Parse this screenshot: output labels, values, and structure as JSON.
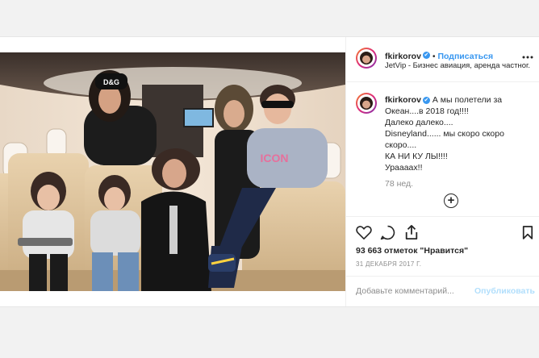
{
  "header": {
    "username": "fkirkorov",
    "verified_mark": "✔",
    "separator": "•",
    "follow_label": "Подписаться",
    "location": "JetVip - Бизнес авиация, аренда частног...",
    "more_icon": "more-horizontal-icon"
  },
  "caption": {
    "username": "fkirkorov",
    "lines": [
      "А мы полетели за",
      "Океан....в 2018 год!!!!",
      "Далеко далеко....",
      "Disneyland...... мы скоро скоро",
      "скоро....",
      "КА НИ КУ ЛЫ!!!!",
      "Ураааах!!"
    ],
    "time_ago": "78 нед.",
    "load_more_icon": "plus-circle-icon"
  },
  "actions": {
    "icons": [
      "heart-icon",
      "comment-icon",
      "share-icon",
      "bookmark-icon"
    ],
    "likes": "93 663 отметок \"Нравится\"",
    "date": "31 ДЕКАБРЯ 2017 Г."
  },
  "comment": {
    "placeholder": "Добавьте комментарий...",
    "publish_label": "Опубликовать"
  },
  "photo": {
    "cap_text": "D&G",
    "shirt_text": "ICON"
  },
  "colors": {
    "accent": "#3897f0",
    "muted": "#8e8e8e",
    "publish_disabled": "#b2dffc"
  }
}
